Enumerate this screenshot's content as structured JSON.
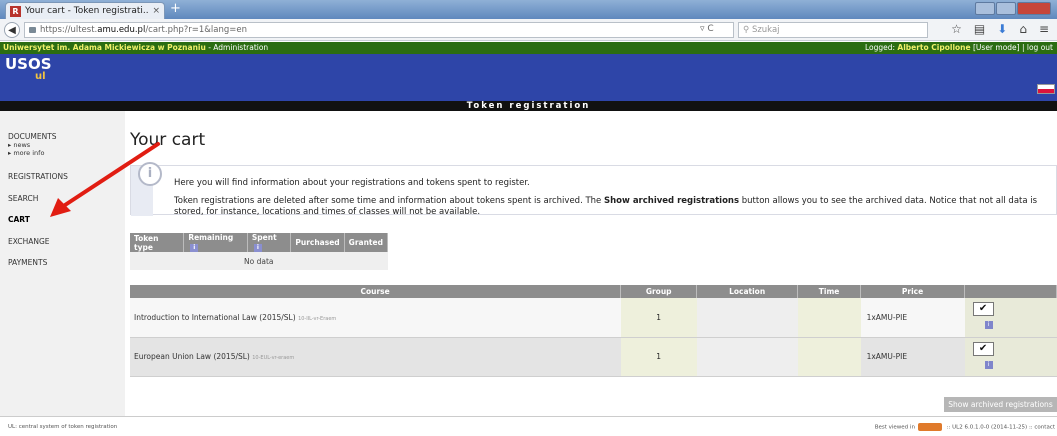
{
  "browser": {
    "tab_title": "Your cart - Token registrati...",
    "tab_favicon_letter": "R",
    "tab_close": "×",
    "new_tab": "+",
    "url_prefix": "https://ultest.",
    "url_host": "amu.edu.pl",
    "url_suffix": "/cart.php?r=1&lang=en",
    "search_placeholder": "Szukaj"
  },
  "header": {
    "university": "Uniwersytet im. Adama Mickiewicza w Poznaniu",
    "section": " - Administration",
    "logged_label": "Logged: ",
    "logged_user": "Alberto Cipollone",
    "user_mode": " [User mode] | log out",
    "logo": "USOS",
    "logo_sub": "ul",
    "app_title": "Token registration",
    "flag_colors": [
      "#ffffff",
      "#dc143c"
    ]
  },
  "sidebar": {
    "documents": "DOCUMENTS",
    "news": "▸ news",
    "more_info": "▸ more info",
    "registrations": "REGISTRATIONS",
    "search": "SEARCH",
    "cart": "CART",
    "exchange": "EXCHANGE",
    "payments": "PAYMENTS"
  },
  "main": {
    "title": "Your cart",
    "info_line1": "Here you will find information about your registrations and tokens spent to register.",
    "info_line2_a": "Token registrations are deleted after some time and information about tokens spent is archived. The ",
    "info_line2_bold": "Show archived registrations",
    "info_line2_b": " button allows you to see the archived data. Notice that not all data is stored, for instance, locations and times of classes will not be available."
  },
  "token_table": {
    "headers": [
      "Token type",
      "Remaining",
      "Spent",
      "Purchased",
      "Granted"
    ],
    "info_glyph": "i",
    "empty": "No data"
  },
  "course_table": {
    "headers": [
      "Course",
      "Group",
      "Location",
      "Time",
      "Price",
      ""
    ],
    "rows": [
      {
        "course": "Introduction to International Law (2015/SL)",
        "code": "10-IIL-vr-Eraem",
        "group": "1",
        "location": "",
        "time": "",
        "price": "1xAMU-PIE"
      },
      {
        "course": "European Union Law (2015/SL)",
        "code": "10-EUL-vr-eraem",
        "group": "1",
        "location": "",
        "time": "",
        "price": "1xAMU-PIE"
      }
    ],
    "check_glyph": "✔",
    "info_glyph": "i"
  },
  "actions": {
    "show_archived": "Show archived registrations"
  },
  "footer": {
    "left": "UL: central system of token registration",
    "best_viewed": "Best viewed in",
    "version": " :: UL2 6.0.1.0-0 (2014-11-25) :: contact"
  }
}
